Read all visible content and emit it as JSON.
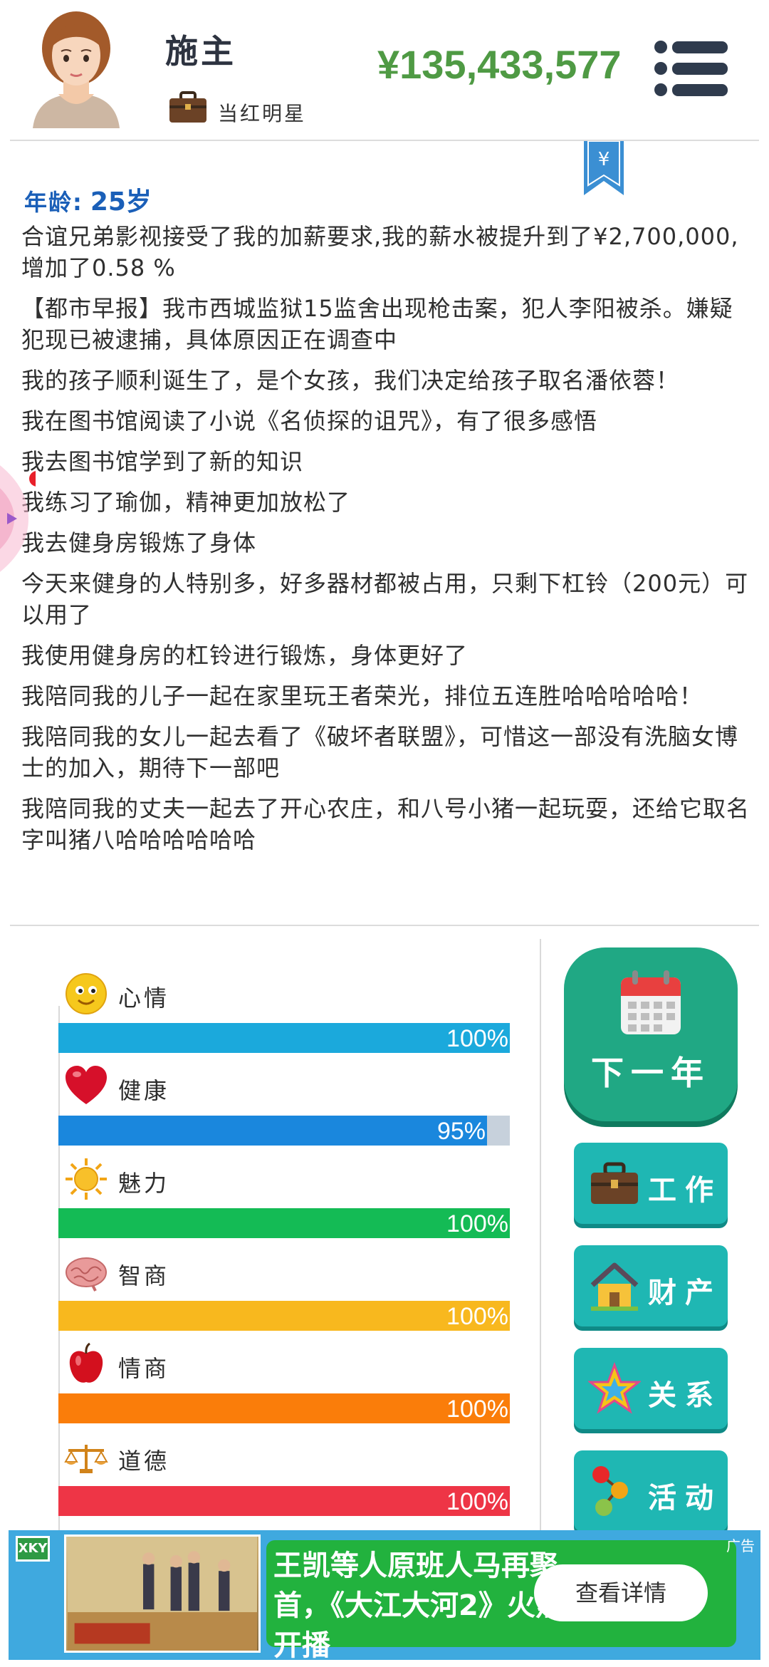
{
  "header": {
    "name": "施主",
    "job_title": "当红明星",
    "money": "¥135,433,577"
  },
  "info": {
    "age_label": "年龄:",
    "age_value": "25岁"
  },
  "log": [
    "合谊兄弟影视接受了我的加薪要求,我的薪水被提升到了¥2,700,000,增加了0.58 %",
    "【都市早报】我市西城监狱15监舍出现枪击案，犯人李阳被杀。嫌疑犯现已被逮捕，具体原因正在调查中",
    "我的孩子顺利诞生了，是个女孩，我们决定给孩子取名潘依蓉！",
    "我在图书馆阅读了小说《名侦探的诅咒》，有了很多感悟",
    "我去图书馆学到了新的知识",
    "我练习了瑜伽，精神更加放松了",
    "我去健身房锻炼了身体",
    "今天来健身的人特别多，好多器材都被占用，只剩下杠铃（200元）可以用了",
    "我使用健身房的杠铃进行锻炼，身体更好了",
    "我陪同我的儿子一起在家里玩王者荣光，排位五连胜哈哈哈哈哈！",
    "我陪同我的女儿一起去看了《破坏者联盟》，可惜这一部没有洗脑女博士的加入，期待下一部吧",
    "我陪同我的丈夫一起去了开心农庄，和八号小猪一起玩耍，还给它取名字叫猪八哈哈哈哈哈哈"
  ],
  "stats": [
    {
      "label": "心情",
      "value": 100,
      "text": "100%",
      "color": "#1ba9dc",
      "icon": "smiley-icon"
    },
    {
      "label": "健康",
      "value": 95,
      "text": "95%",
      "color": "#1a87dd",
      "icon": "heart-icon"
    },
    {
      "label": "魅力",
      "value": 100,
      "text": "100%",
      "color": "#14bb55",
      "icon": "sun-icon"
    },
    {
      "label": "智商",
      "value": 100,
      "text": "100%",
      "color": "#f8b81e",
      "icon": "brain-icon"
    },
    {
      "label": "情商",
      "value": 100,
      "text": "100%",
      "color": "#fa7d0a",
      "icon": "apple-icon"
    },
    {
      "label": "道德",
      "value": 100,
      "text": "100%",
      "color": "#ee3546",
      "icon": "scales-icon"
    }
  ],
  "actions": {
    "next_year": "下一年",
    "work": "工作",
    "property": "财产",
    "relations": "关系",
    "activities": "活动"
  },
  "ad": {
    "logo": "XKY",
    "text": "王凯等人原班人马再聚首，《大江大河2》火热开播",
    "cta": "查看详情",
    "tag": "广告"
  },
  "colors": {
    "money": "#4f9a44",
    "age": "#1a5fb8",
    "next_year_button": "#20a884",
    "action_button": "#1fb7b3"
  }
}
